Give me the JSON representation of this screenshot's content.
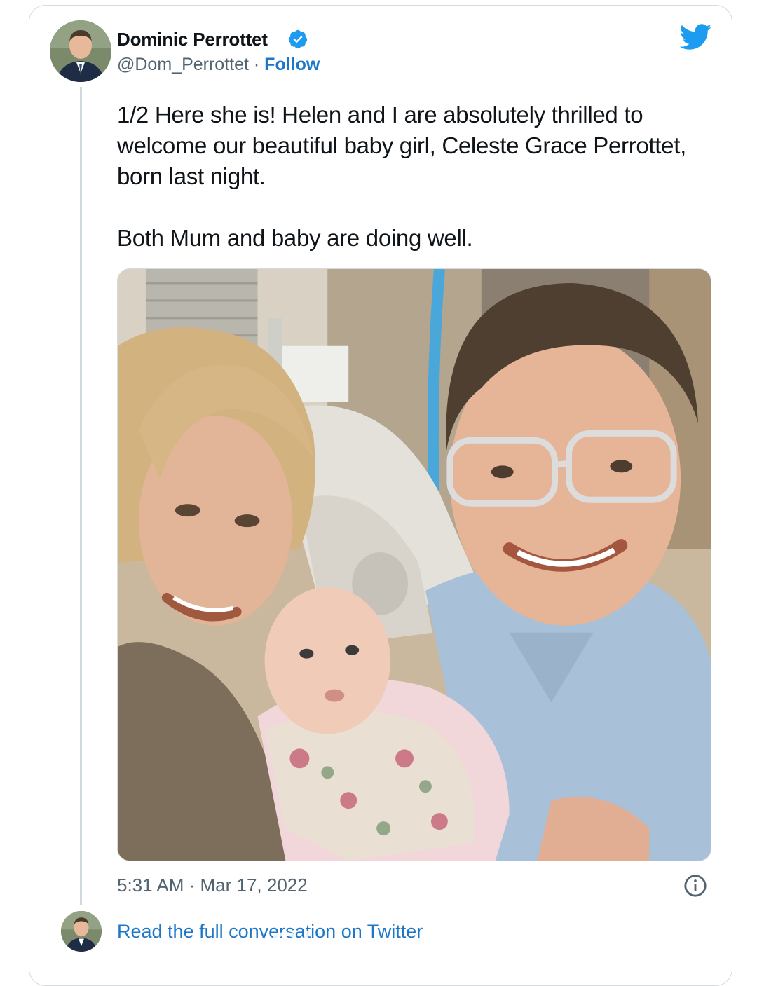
{
  "tweet": {
    "author_name": "Dominic Perrottet",
    "handle": "@Dom_Perrottet",
    "separator": " · ",
    "follow_label": "Follow",
    "text_paragraphs": [
      "1/2 Here she is! Helen and I are absolutely thrilled to welcome our beautiful baby girl, Celeste Grace Perrottet, born last night.",
      "Both Mum and baby are doing well."
    ],
    "timestamp": "5:31 AM · Mar 17, 2022",
    "read_more_label": "Read the full conversation on Twitter"
  },
  "icons": {
    "verified": "verified-badge-icon",
    "brand": "twitter-bird-icon",
    "info": "info-icon"
  },
  "colors": {
    "link": "#1d77c9",
    "verified": "#1d9bf0",
    "brand": "#1d9bf0",
    "text": "#0f1419",
    "muted": "#536471",
    "border": "#d6dbe0"
  },
  "watermark": "Chinazau"
}
